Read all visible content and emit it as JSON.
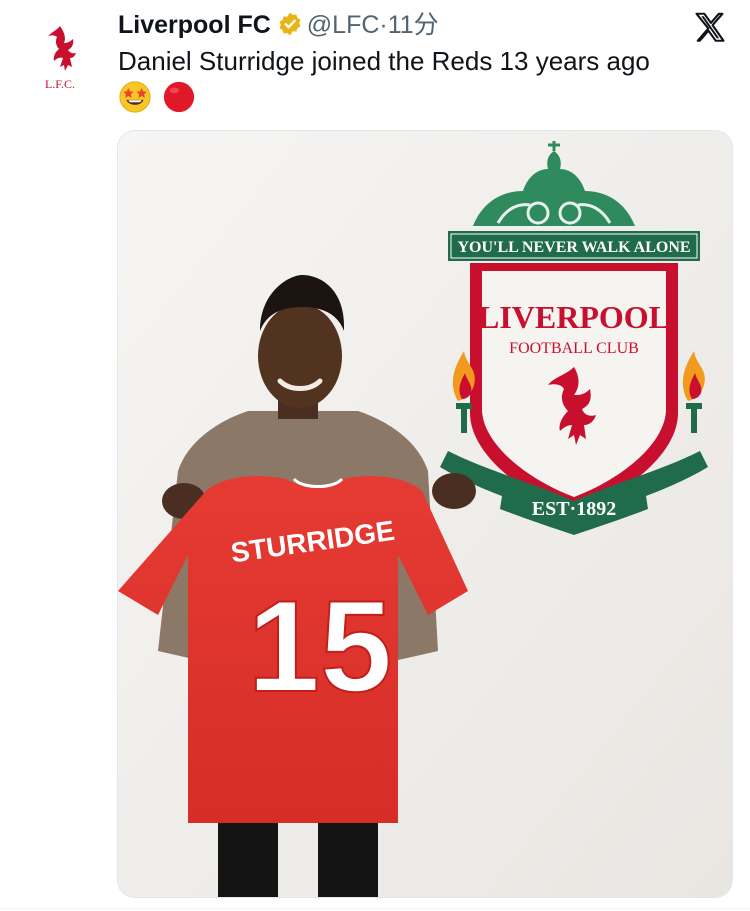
{
  "tweet": {
    "display_name": "Liverpool FC",
    "handle": "@LFC",
    "separator": "·",
    "time_ago": "11分",
    "text": "Daniel Sturridge joined the Reds 13 years ago",
    "emojis": [
      "star-struck-emoji",
      "red-circle-emoji"
    ],
    "avatar_label": "L.F.C."
  },
  "media": {
    "crest_banner": "YOU'LL NEVER WALK ALONE",
    "crest_title": "LIVERPOOL",
    "crest_subtitle": "FOOTBALL CLUB",
    "crest_est": "EST·1892",
    "shirt_name": "STURRIDGE",
    "shirt_number": "15"
  },
  "colors": {
    "lfc_red": "#c8102e",
    "crest_green": "#1f6b4a",
    "verified_gold": "#e8b417",
    "handle_gray": "#536471"
  }
}
